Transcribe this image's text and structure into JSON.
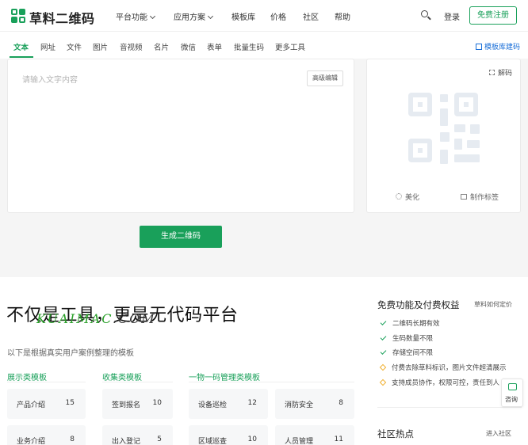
{
  "header": {
    "brand": "草料二维码",
    "nav": [
      {
        "label": "平台功能",
        "dropdown": true
      },
      {
        "label": "应用方案",
        "dropdown": true
      },
      {
        "label": "模板库",
        "dropdown": false
      },
      {
        "label": "价格",
        "dropdown": false
      },
      {
        "label": "社区",
        "dropdown": false
      },
      {
        "label": "帮助",
        "dropdown": false
      }
    ],
    "login": "登录",
    "register": "免费注册"
  },
  "tabs": [
    "文本",
    "网址",
    "文件",
    "图片",
    "音视频",
    "名片",
    "微信",
    "表单",
    "批量生码",
    "更多工具"
  ],
  "active_tab": "文本",
  "template_link": "模板库建码",
  "editor": {
    "placeholder": "请输入文字内容",
    "advanced": "高级编辑"
  },
  "qr_panel": {
    "decode": "解码",
    "beautify": "美化",
    "make_label": "制作标签"
  },
  "generate_button": "生成二维码",
  "lower": {
    "slogan": "不仅是工具，更是无代码平台",
    "watermark_a": "KUAIMAC",
    "watermark_b": ".COM",
    "subtitle": "以下是根据真实用户案例整理的模板",
    "categories": [
      {
        "title": "展示类模板",
        "items": [
          {
            "label": "产品介绍",
            "count": "15"
          },
          {
            "label": "业务介绍",
            "count": "8"
          }
        ]
      },
      {
        "title": "收集类模板",
        "items": [
          {
            "label": "签到报名",
            "count": "10"
          },
          {
            "label": "出入登记",
            "count": "5"
          }
        ]
      },
      {
        "title": "一物一码管理类模板",
        "items": [
          {
            "label": "设备巡检",
            "count": "12"
          },
          {
            "label": "消防安全",
            "count": "8"
          },
          {
            "label": "区域巡查",
            "count": "10"
          },
          {
            "label": "人员管理",
            "count": "11"
          }
        ]
      }
    ]
  },
  "benefits": {
    "title": "免费功能及付费权益",
    "link": "草料如何定价",
    "free": [
      "二维码长期有效",
      "生码数量不限",
      "存储空间不限"
    ],
    "paid": [
      "付费去除草料标识，图片文件超清展示",
      "支持成员协作，权限可控，责任到人"
    ]
  },
  "community": {
    "title": "社区热点",
    "link": "进入社区"
  },
  "consult": "咨询",
  "colors": {
    "brand": "#19a05a",
    "link": "#1a6fd8",
    "paid": "#f0b030"
  }
}
